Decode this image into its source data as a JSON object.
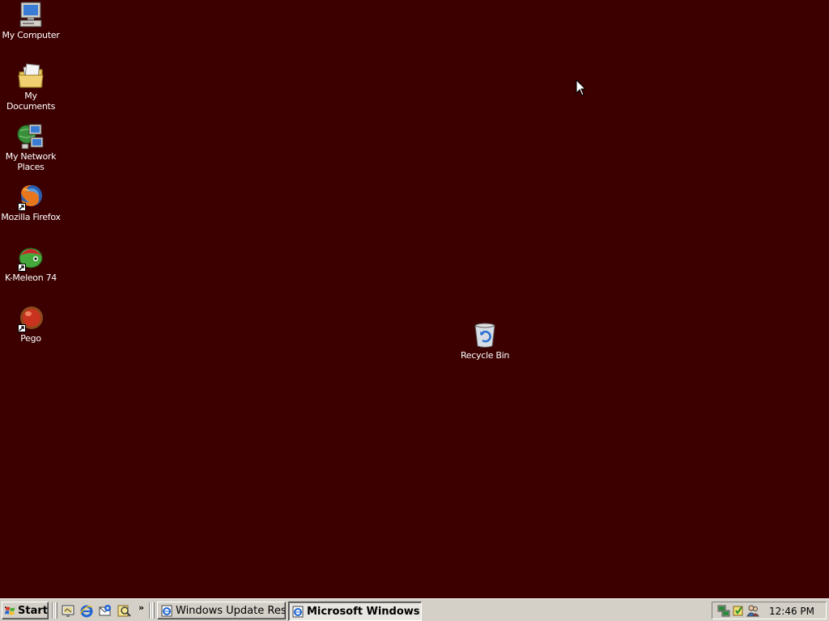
{
  "desktop": {
    "background": "#3c0000",
    "icons": {
      "my_computer": "My Computer",
      "my_documents": "My Documents",
      "network_line1": "My Network",
      "network_line2": "Places",
      "firefox": "Mozilla Firefox",
      "kmeleon": "K-Meleon 74",
      "pego": "Pego",
      "recycle_bin": "Recycle Bin"
    }
  },
  "taskbar": {
    "start_label": "Start",
    "quick_launch_icons": [
      "show-desktop-icon",
      "internet-explorer-icon",
      "outlook-express-icon",
      "windows-media-icon"
    ],
    "more_label": "»",
    "tasks": [
      {
        "label": "Windows Update Rest...",
        "icon": "ie-page-icon",
        "active": false
      },
      {
        "label": "Microsoft Windows ...",
        "icon": "ie-page-icon",
        "active": true
      }
    ],
    "tray_icons": [
      "network-icon",
      "security-icon",
      "users-icon"
    ],
    "clock": "12:46 PM"
  }
}
